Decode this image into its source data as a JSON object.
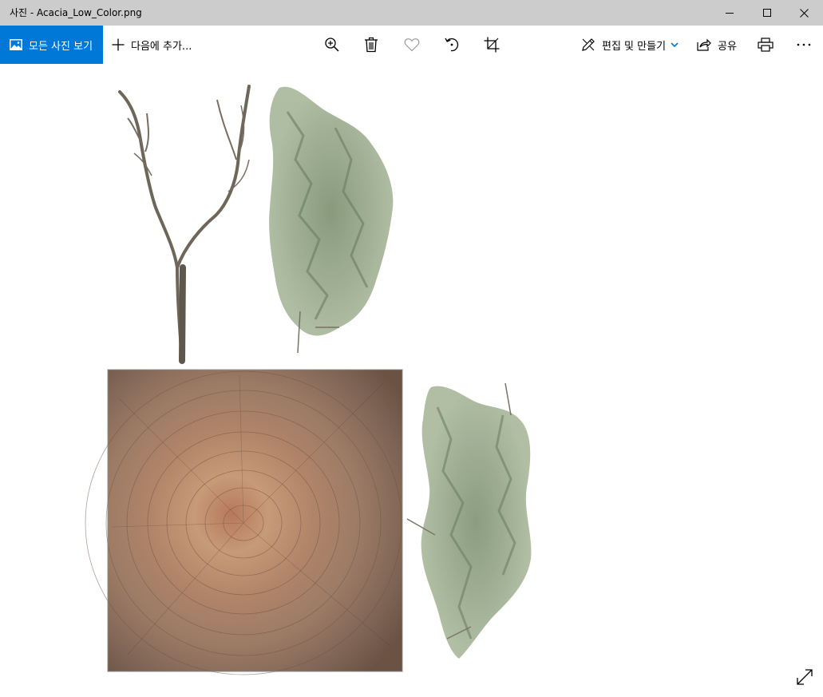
{
  "window": {
    "title": "사진 - Acacia_Low_Color.png",
    "controls": [
      "minimize-icon",
      "maximize-icon",
      "close-icon"
    ]
  },
  "toolbar": {
    "all_photos_label": "모든 사진 보기",
    "add_to_label": "다음에 추가...",
    "edit_create_label": "편집 및 만들기",
    "share_label": "공유",
    "tools": [
      "zoom-in-icon",
      "delete-icon",
      "favorite-icon",
      "rotate-icon",
      "crop-icon",
      "print-icon",
      "more-icon"
    ]
  },
  "colors": {
    "accent": "#0078d7",
    "titlebar": "#cccccc",
    "background": "#ffffff"
  },
  "viewer": {
    "fullscreen_icon": "expand-icon"
  }
}
